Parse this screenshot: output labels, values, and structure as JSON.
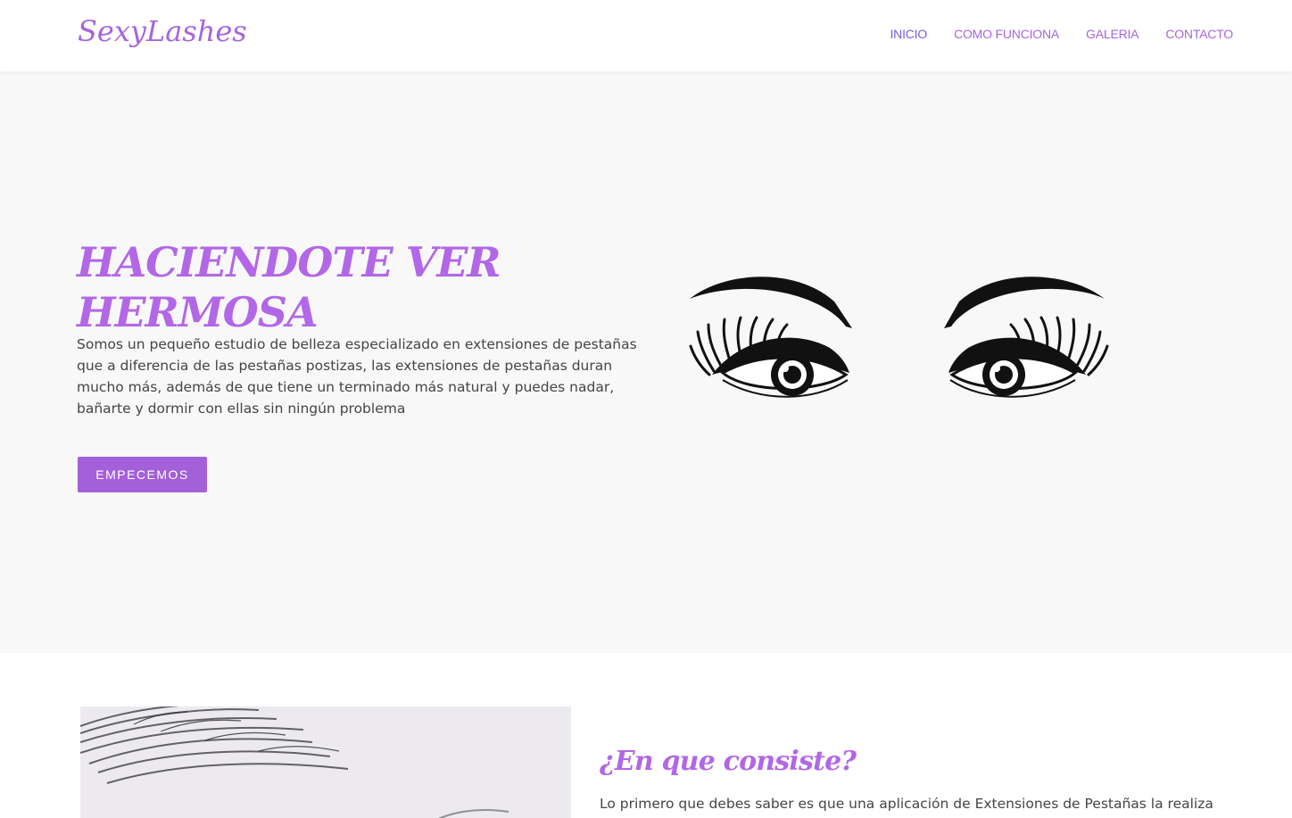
{
  "brand": "SexyLashes",
  "nav": {
    "items": [
      {
        "label": "INICIO"
      },
      {
        "label": "COMO FUNCIONA"
      },
      {
        "label": "GALERIA"
      },
      {
        "label": "CONTACTO"
      }
    ]
  },
  "hero": {
    "title": "HACIENDOTE VER HERMOSA",
    "text": "Somos un pequeño estudio de belleza especializado en extensiones de pestañas que a diferencia de las pestañas postizas, las extensiones de pestañas duran mucho más, además de que tiene un terminado más natural y puedes nadar, bañarte y dormir con ellas sin ningún problema",
    "cta_label": "EMPECEMOS"
  },
  "section2": {
    "title": "¿En que consiste?",
    "text": "Lo primero que debes saber es que una aplicación de Extensiones de Pestañas la realiza"
  },
  "colors": {
    "accent": "#a565dd",
    "button": "#a360d8",
    "hero_bg": "#f8f8f8"
  },
  "icons": {
    "hero_image": "eyes-with-lashes-illustration",
    "section_image": "eyelash-closeup-photo"
  }
}
